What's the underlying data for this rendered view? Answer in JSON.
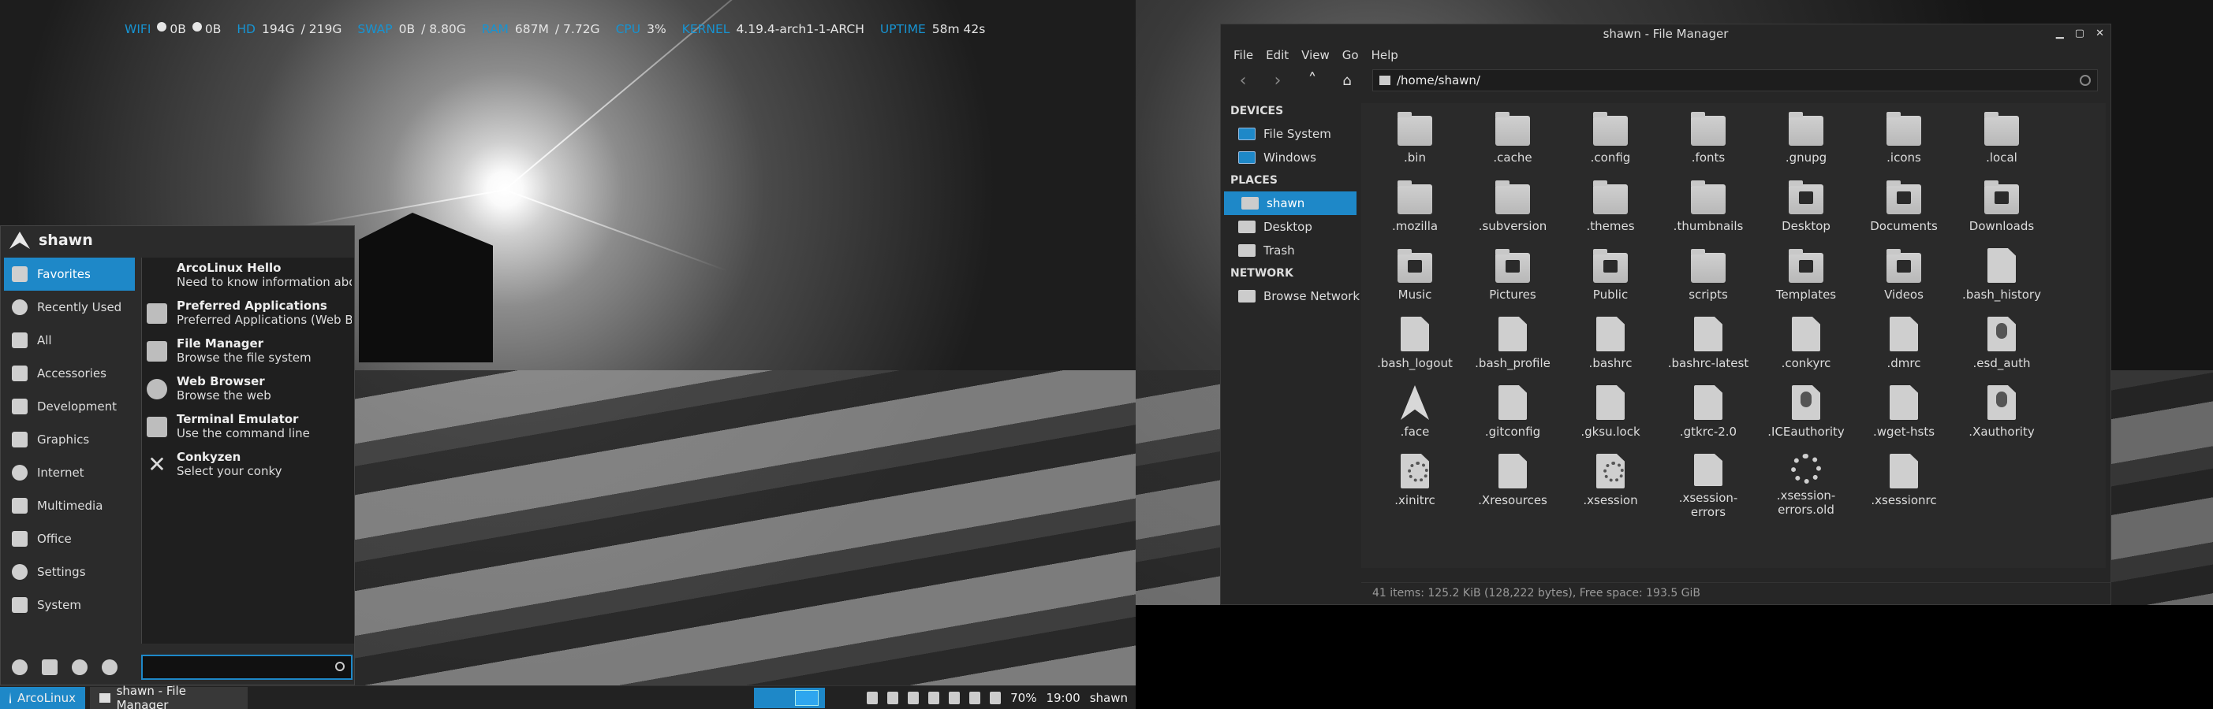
{
  "conky": {
    "wifi_label": "WIFI",
    "wifi_down": "0B",
    "wifi_up": "0B",
    "hd_label": "HD",
    "hd_used": "194G",
    "hd_total": "/ 219G",
    "swap_label": "SWAP",
    "swap_used": "0B",
    "swap_total": "/ 8.80G",
    "ram_label": "RAM",
    "ram_used": "687M",
    "ram_total": "/ 7.72G",
    "cpu_label": "CPU",
    "cpu_value": "3%",
    "kernel_label": "KERNEL",
    "kernel_value": "4.19.4-arch1-1-ARCH",
    "uptime_label": "UPTIME",
    "uptime_value": "58m 42s"
  },
  "menu": {
    "username": "shawn",
    "categories": [
      {
        "label": "Favorites",
        "icon": "bookmark-icon"
      },
      {
        "label": "Recently Used",
        "icon": "clock-icon"
      },
      {
        "label": "All",
        "icon": "grid-icon"
      },
      {
        "label": "Accessories",
        "icon": "tools-icon"
      },
      {
        "label": "Development",
        "icon": "code-icon"
      },
      {
        "label": "Graphics",
        "icon": "graphics-icon"
      },
      {
        "label": "Internet",
        "icon": "globe-icon"
      },
      {
        "label": "Multimedia",
        "icon": "media-icon"
      },
      {
        "label": "Office",
        "icon": "office-icon"
      },
      {
        "label": "Settings",
        "icon": "gear-icon"
      },
      {
        "label": "System",
        "icon": "system-icon"
      }
    ],
    "apps": [
      {
        "name": "ArcoLinux Hello",
        "desc": "Need to know information abo..."
      },
      {
        "name": "Preferred Applications",
        "desc": "Preferred Applications (Web Br..."
      },
      {
        "name": "File Manager",
        "desc": "Browse the file system"
      },
      {
        "name": "Web Browser",
        "desc": "Browse the web"
      },
      {
        "name": "Terminal Emulator",
        "desc": "Use the command line"
      },
      {
        "name": "Conkyzen",
        "desc": "Select your conky"
      }
    ],
    "search_value": ""
  },
  "panel": {
    "start_label": "ArcoLinux",
    "task_label": "shawn - File Manager",
    "battery": "70%",
    "clock": "19:00",
    "user": "shawn"
  },
  "fm": {
    "title": "shawn - File Manager",
    "menu": [
      "File",
      "Edit",
      "View",
      "Go",
      "Help"
    ],
    "path": "/home/shawn/",
    "devices_header": "DEVICES",
    "devices": [
      "File System",
      "Windows"
    ],
    "places_header": "PLACES",
    "places": [
      "shawn",
      "Desktop",
      "Trash"
    ],
    "network_header": "NETWORK",
    "network": [
      "Browse Network"
    ],
    "items": [
      [
        ".bin",
        ".cache",
        ".config",
        ".fonts",
        ".gnupg",
        ".icons",
        ".local"
      ],
      [
        ".mozilla",
        ".subversion",
        ".themes",
        ".thumbnails",
        "Desktop",
        "Documents",
        "Downloads"
      ],
      [
        "Music",
        "Pictures",
        "Public",
        "scripts",
        "Templates",
        "Videos",
        ".bash_history"
      ],
      [
        ".bash_logout",
        ".bash_profile",
        ".bashrc",
        ".bashrc-latest",
        ".conkyrc",
        ".dmrc",
        ".esd_auth"
      ],
      [
        ".face",
        ".gitconfig",
        ".gksu.lock",
        ".gtkrc-2.0",
        ".ICEauthority",
        ".wget-hsts",
        ".Xauthority"
      ],
      [
        ".xinitrc",
        ".Xresources",
        ".xsession",
        ".xsession-errors",
        ".xsession-errors.old",
        ".xsessionrc"
      ]
    ],
    "status": "41 items: 125.2 KiB (128,222 bytes), Free space: 193.5 GiB"
  }
}
